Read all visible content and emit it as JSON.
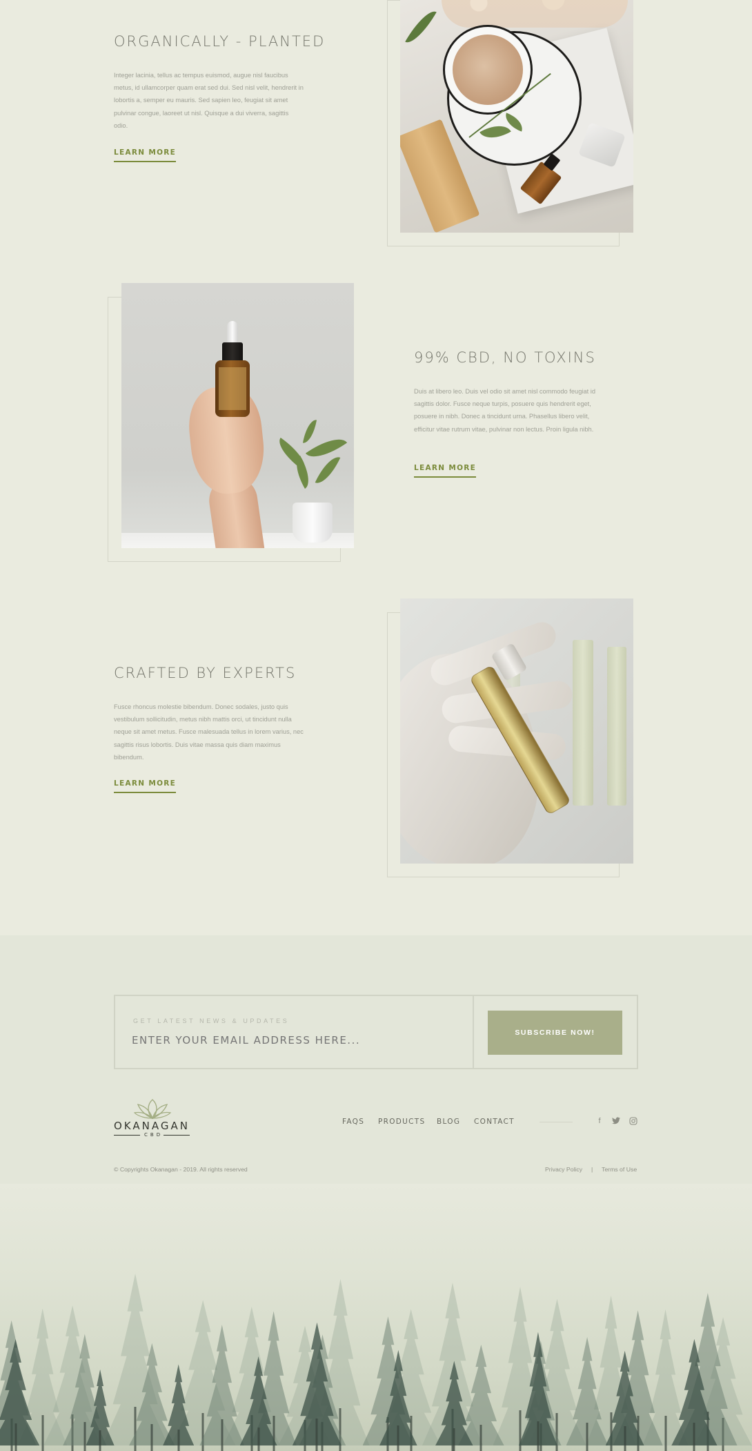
{
  "features": [
    {
      "title": "ORGANICALLY - PLANTED",
      "body": "Integer lacinia, tellus ac tempus euismod, augue nisl faucibus metus, id ullamcorper quam erat sed dui. Sed nisl velit, hendrerit in lobortis a, semper eu mauris. Sed sapien leo, feugiat sit amet pulvinar congue, laoreet ut nisl. Quisque a dui viverra, sagittis odio.",
      "link": "LEARN MORE"
    },
    {
      "title": "99% CBD, NO TOXINS",
      "body": "Duis at libero leo. Duis vel odio sit amet nisl commodo feugiat id sagittis dolor. Fusce neque turpis, posuere quis hendrerit eget, posuere in nibh. Donec a tincidunt urna. Phasellus libero velit, efficitur vitae rutrum vitae, pulvinar non lectus. Proin ligula nibh.",
      "link": "LEARN MORE"
    },
    {
      "title": "CRAFTED BY EXPERTS",
      "body": "Fusce rhoncus molestie bibendum. Donec sodales, justo quis vestibulum sollicitudin, metus nibh mattis orci, ut tincidunt nulla neque sit amet metus. Fusce malesuada tellus in lorem varius, nec sagittis risus lobortis. Duis vitae massa quis diam maximus bibendum.",
      "link": "LEARN MORE"
    }
  ],
  "newsletter": {
    "kicker": "GET LATEST NEWS & UPDATES",
    "placeholder": "ENTER YOUR EMAIL ADDRESS HERE...",
    "button": "SUBSCRIBE NOW!"
  },
  "footer": {
    "logo": {
      "word": "OKANAGAN",
      "sub": "CBD"
    },
    "nav": [
      "FAQS",
      "PRODUCTS",
      "BLOG",
      "CONTACT"
    ],
    "social": [
      {
        "icon": "facebook-icon",
        "glyph": "f"
      },
      {
        "icon": "twitter-icon",
        "glyph": "🐦"
      },
      {
        "icon": "instagram-icon",
        "glyph": "◎"
      }
    ],
    "copyright": "© Copyrights Okanagan - 2019. All rights reserved",
    "legal": [
      "Privacy Policy",
      "Terms of Use"
    ],
    "legal_separator": "|"
  },
  "colors": {
    "background": "#eaebdf",
    "accent": "#7b8b3b",
    "button": "#a9af8a",
    "band": "#e3e6d9"
  }
}
